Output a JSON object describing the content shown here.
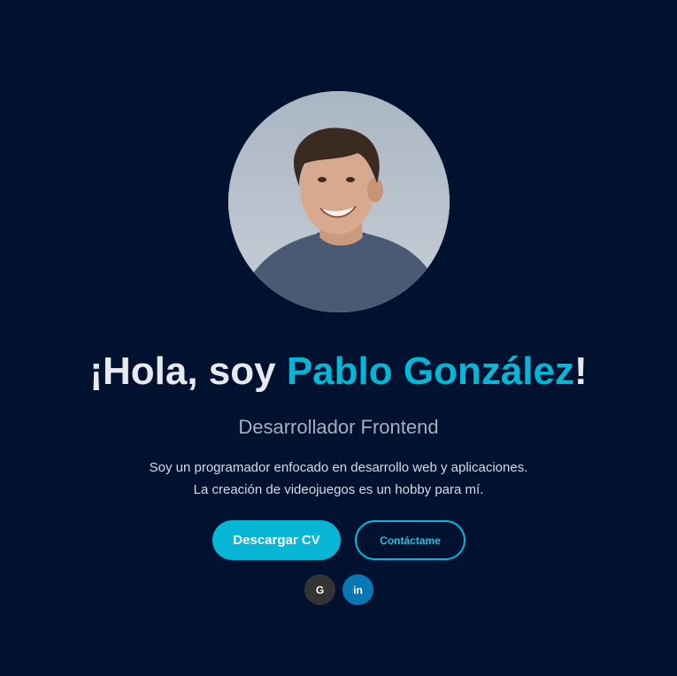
{
  "hero": {
    "headline_prefix": "¡Hola, soy ",
    "headline_name": "Pablo González",
    "headline_suffix": "!",
    "subtitle": "Desarrollador Frontend",
    "bio_line1": "Soy un programador enfocado en desarrollo web y aplicaciones.",
    "bio_line2": "La creación de videojuegos es un hobby para mí."
  },
  "actions": {
    "download_cv": "Descargar CV",
    "contact": "Contáctame"
  },
  "social": {
    "github_label": "G",
    "linkedin_label": "in"
  },
  "colors": {
    "background": "#001230",
    "accent": "#06b6d4",
    "github": "#333333",
    "linkedin": "#0a77b5"
  }
}
